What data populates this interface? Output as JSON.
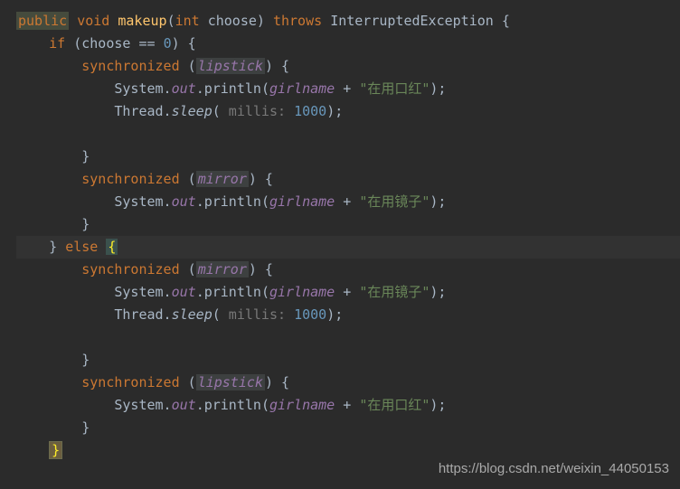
{
  "code": {
    "l1": {
      "public": "public",
      "void": "void",
      "method": "makeup",
      "lp": "(",
      "int": "int",
      "param": "choose",
      "rp": ")",
      "throws": "throws",
      "ex": "InterruptedException",
      "lb": "{"
    },
    "l2": {
      "indent": "    ",
      "if": "if",
      "cond": " (choose == ",
      "zero": "0",
      "rp": ") {"
    },
    "l3": {
      "indent": "        ",
      "sync": "synchronized",
      "lp": " (",
      "field": "lipstick",
      "rp": ") {"
    },
    "l4": {
      "indent": "            ",
      "sys": "System.",
      "out": "out",
      "dot": ".",
      "method": "println",
      "lp": "(",
      "var": "girlname",
      "plus": " + ",
      "str": "\"在用口红\"",
      "end": ");"
    },
    "l5": {
      "indent": "            ",
      "thread": "Thread.",
      "sleep": "sleep",
      "lp": "(",
      "hint": " millis: ",
      "num": "1000",
      "end": ");"
    },
    "l6": {
      "blank": " "
    },
    "l7": {
      "indent": "        ",
      "rb": "}"
    },
    "l8": {
      "indent": "        ",
      "sync": "synchronized",
      "lp": " (",
      "field": "mirror",
      "rp": ") {"
    },
    "l9": {
      "indent": "            ",
      "sys": "System.",
      "out": "out",
      "dot": ".",
      "method": "println",
      "lp": "(",
      "var": "girlname",
      "plus": " + ",
      "str": "\"在用镜子\"",
      "end": ");"
    },
    "l10": {
      "indent": "        ",
      "rb": "}"
    },
    "l11": {
      "indent": "    ",
      "rb": "} ",
      "else": "else",
      "sp": " ",
      "lb": "{"
    },
    "l12": {
      "indent": "        ",
      "sync": "synchronized",
      "lp": " (",
      "field": "mirror",
      "rp": ") {"
    },
    "l13": {
      "indent": "            ",
      "sys": "System.",
      "out": "out",
      "dot": ".",
      "method": "println",
      "lp": "(",
      "var": "girlname",
      "plus": " + ",
      "str": "\"在用镜子\"",
      "end": ");"
    },
    "l14": {
      "indent": "            ",
      "thread": "Thread.",
      "sleep": "sleep",
      "lp": "(",
      "hint": " millis: ",
      "num": "1000",
      "end": ");"
    },
    "l15": {
      "blank": " "
    },
    "l16": {
      "indent": "        ",
      "rb": "}"
    },
    "l17": {
      "indent": "        ",
      "sync": "synchronized",
      "lp": " (",
      "field": "lipstick",
      "rp": ") {"
    },
    "l18": {
      "indent": "            ",
      "sys": "System.",
      "out": "out",
      "dot": ".",
      "method": "println",
      "lp": "(",
      "var": "girlname",
      "plus": " + ",
      "str": "\"在用口红\"",
      "end": ");"
    },
    "l19": {
      "indent": "        ",
      "rb": "}"
    },
    "l20": {
      "indent": "    ",
      "rb": "}"
    }
  },
  "watermark": "https://blog.csdn.net/weixin_44050153"
}
